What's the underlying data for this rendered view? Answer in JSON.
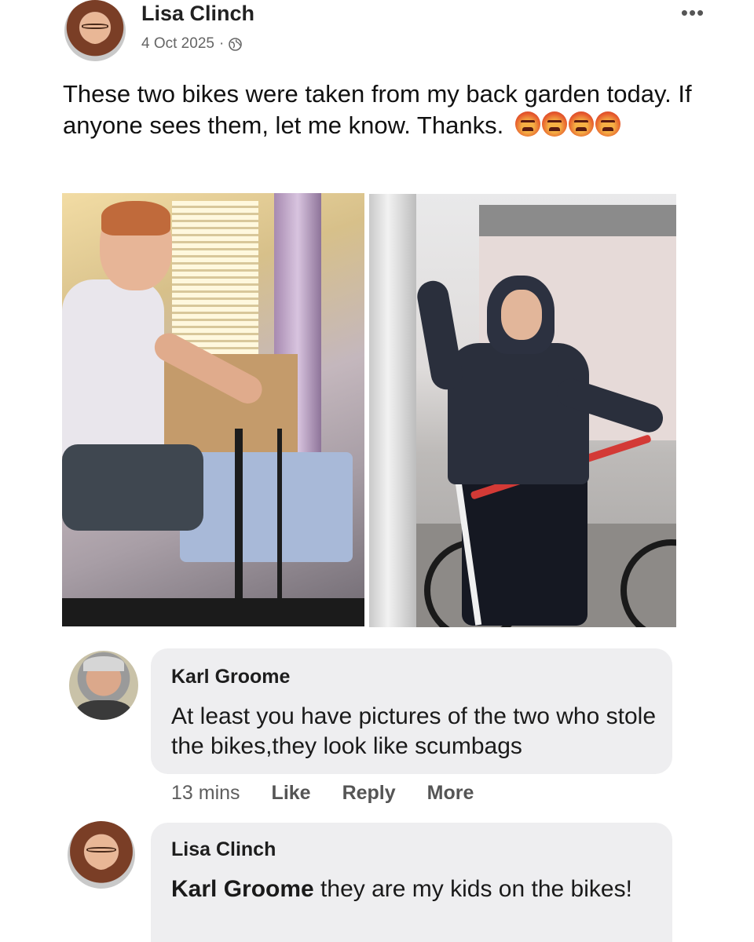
{
  "post": {
    "author": "Lisa Clinch",
    "date": "4 Oct 2025",
    "separator": "·",
    "privacy_icon": "globe-icon",
    "more_icon": "more-options-icon",
    "more_glyph": "•••",
    "text": "These two bikes were taken from my back garden today. If anyone sees them, let me know. Thanks.",
    "reaction_icons": [
      "angry-face-icon",
      "angry-face-icon",
      "angry-face-icon",
      "angry-face-icon"
    ]
  },
  "photos": [
    {
      "name": "photo-indoor-bike"
    },
    {
      "name": "photo-outdoor-bike"
    }
  ],
  "comments": [
    {
      "author": "Karl Groome",
      "text": "At least you have pictures of the two who stole the bikes,they look like scumbags",
      "time": "13 mins",
      "actions": {
        "like": "Like",
        "reply": "Reply",
        "more": "More"
      }
    },
    {
      "author": "Lisa Clinch",
      "mention": "Karl Groome",
      "text": " they are my kids on the bikes!"
    }
  ],
  "colors": {
    "bubble": "#eeeef0",
    "meta_text": "#656565",
    "reaction": "#e65c2d"
  }
}
